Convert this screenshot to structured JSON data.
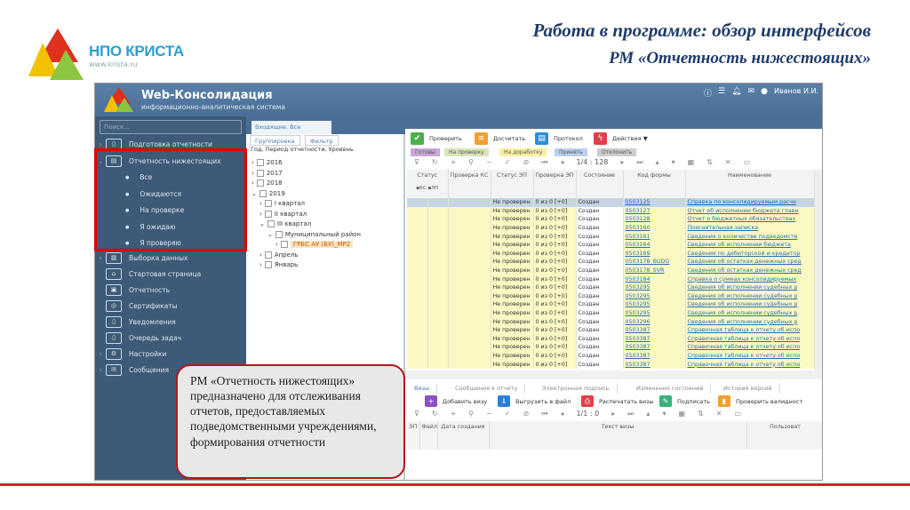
{
  "slide": {
    "brand": "НПО КРИСТА",
    "site": "www.krista.ru",
    "title_line1": "Работа в программе: обзор интерфейсов",
    "title_line2": "РМ «Отчетность нижестоящих»"
  },
  "app": {
    "title": "Web-Консолидация",
    "subtitle": "информационно-аналитическая система",
    "user": "Иванов И.И.",
    "header_icons": [
      "info-icon",
      "list-icon",
      "bell-icon",
      "mail-icon",
      "user-icon"
    ]
  },
  "sidebar": {
    "search_placeholder": "Поиск...",
    "items": [
      {
        "label": "Подготовка отчетности",
        "icon": "doc-icon"
      },
      {
        "label": "Отчетность нижестоящих",
        "icon": "docs-icon"
      },
      {
        "label": "Выборка данных",
        "icon": "data-icon"
      },
      {
        "label": "Стартовая страница",
        "icon": "home-icon"
      },
      {
        "label": "Отчетность",
        "icon": "report-icon"
      },
      {
        "label": "Сертификаты",
        "icon": "cert-icon"
      },
      {
        "label": "Уведомления",
        "icon": "notify-icon"
      },
      {
        "label": "Очередь задач",
        "icon": "queue-icon"
      },
      {
        "label": "Настройки",
        "icon": "gear-icon"
      },
      {
        "label": "Сообщения",
        "icon": "mail-icon"
      }
    ],
    "subitems": [
      "Все",
      "Ожидаются",
      "На проверке",
      "Я ожидаю",
      "Я проверяю"
    ]
  },
  "middle": {
    "tab": "Входящие. Все",
    "grouping": "Группировка",
    "filter": "Фильтр",
    "group_fields": "Год, Период отчетности, Уровень",
    "tree": [
      "2016",
      "2017",
      "2018",
      "2019",
      "I квартал",
      "II квартал",
      "III квартал",
      "Муниципальный район",
      "ГРБС АУ (БУ)_МР2",
      "Апрель",
      "Январь"
    ]
  },
  "toolbar": {
    "check": "Проверить",
    "recalc": "Досчитать",
    "protocol": "Протокол",
    "actions": "Действия"
  },
  "status_tabs": [
    "Готовы",
    "На проверку",
    "На доработку",
    "Принять",
    "Отклонить"
  ],
  "pager": "1/4 : 128",
  "columns": [
    "Статус",
    "Проверка КС",
    "Статус ЭП",
    "Проверка ЭП",
    "Состояние",
    "Код формы",
    "Наименование"
  ],
  "subcolumns": [
    "КС",
    "ЭП"
  ],
  "rows": [
    {
      "status_ep": "Не проверен",
      "check_ep": "0 из 0 [+0]",
      "state": "Создан",
      "code": "0503125",
      "name": "Справка по консолидируемым расче"
    },
    {
      "status_ep": "Не проверен",
      "check_ep": "0 из 0 [+0]",
      "state": "Создан",
      "code": "0503127",
      "name": "Отчет об исполнении бюджета главн"
    },
    {
      "status_ep": "Не проверен",
      "check_ep": "0 из 0 [+0]",
      "state": "Создан",
      "code": "0503128",
      "name": "Отчет о бюджетных обязательствах"
    },
    {
      "status_ep": "Не проверен",
      "check_ep": "0 из 0 [+0]",
      "state": "Создан",
      "code": "0503160",
      "name": "Пояснительная записка"
    },
    {
      "status_ep": "Не проверен",
      "check_ep": "0 из 0 [+0]",
      "state": "Создан",
      "code": "0503161",
      "name": "Сведения о количестве подведомств"
    },
    {
      "status_ep": "Не проверен",
      "check_ep": "0 из 0 [+0]",
      "state": "Создан",
      "code": "0503164",
      "name": "Сведения об исполнении бюджета"
    },
    {
      "status_ep": "Не проверен",
      "check_ep": "0 из 0 [+0]",
      "state": "Создан",
      "code": "0503169",
      "name": "Сведения по дебиторской и кредитор"
    },
    {
      "status_ep": "Не проверен",
      "check_ep": "0 из 0 [+0]",
      "state": "Создан",
      "code": "0503178_BUDG",
      "name": "Сведения об остатках денежных сред"
    },
    {
      "status_ep": "Не проверен",
      "check_ep": "0 из 0 [+0]",
      "state": "Создан",
      "code": "0503178_SVR",
      "name": "Сведения об остатках денежных сред"
    },
    {
      "status_ep": "Не проверен",
      "check_ep": "0 из 0 [+0]",
      "state": "Создан",
      "code": "0503184",
      "name": "Справка о суммах консолидируемых"
    },
    {
      "status_ep": "Не проверен",
      "check_ep": "0 из 0 [+0]",
      "state": "Создан",
      "code": "0503295",
      "name": "Сведения об исполнении судебных р"
    },
    {
      "status_ep": "Не проверен",
      "check_ep": "0 из 0 [+0]",
      "state": "Создан",
      "code": "0503295",
      "name": "Сведения об исполнении судебных р"
    },
    {
      "status_ep": "Не проверен",
      "check_ep": "0 из 0 [+0]",
      "state": "Создан",
      "code": "0503295",
      "name": "Сведения об исполнении судебных р"
    },
    {
      "status_ep": "Не проверен",
      "check_ep": "0 из 0 [+0]",
      "state": "Создан",
      "code": "0503295",
      "name": "Сведения об исполнении судебных р"
    },
    {
      "status_ep": "Не проверен",
      "check_ep": "0 из 0 [+0]",
      "state": "Создан",
      "code": "0503296",
      "name": "Сведения об исполнении судебных р"
    },
    {
      "status_ep": "Не проверен",
      "check_ep": "0 из 0 [+0]",
      "state": "Создан",
      "code": "0503387",
      "name": "Справочная таблица к отчету об испо"
    },
    {
      "status_ep": "Не проверен",
      "check_ep": "0 из 0 [+0]",
      "state": "Создан",
      "code": "0503387",
      "name": "Справочная таблица к отчету об испо"
    },
    {
      "status_ep": "Не проверен",
      "check_ep": "0 из 0 [+0]",
      "state": "Создан",
      "code": "0503387",
      "name": "Справочная таблица к отчету об испо"
    },
    {
      "status_ep": "Не проверен",
      "check_ep": "0 из 0 [+0]",
      "state": "Создан",
      "code": "0503387",
      "name": "Справочная таблица к отчету об испо"
    },
    {
      "status_ep": "Не проверен",
      "check_ep": "0 из 0 [+0]",
      "state": "Создан",
      "code": "0503387",
      "name": "Справочная таблица к отчету об испо"
    }
  ],
  "bottom": {
    "tabs": [
      "Визы",
      "Сообщения к отчету",
      "Электронная подпись",
      "Изменения состояний",
      "История версий"
    ],
    "buttons": [
      "Добавить визу",
      "Выгрузить в файл",
      "Распечатать визы",
      "Подписать",
      "Проверить валидност"
    ],
    "pager": "1/1 : 0",
    "columns": [
      "ЭП",
      "Файл",
      "Дата создания",
      "Текст визы",
      "Пользоват"
    ]
  },
  "callout": "РМ «Отчетность нижестоящих» предназначено для отслеживания отчетов, предоставляемых подведомственными учреждениями, формирования отчетности"
}
